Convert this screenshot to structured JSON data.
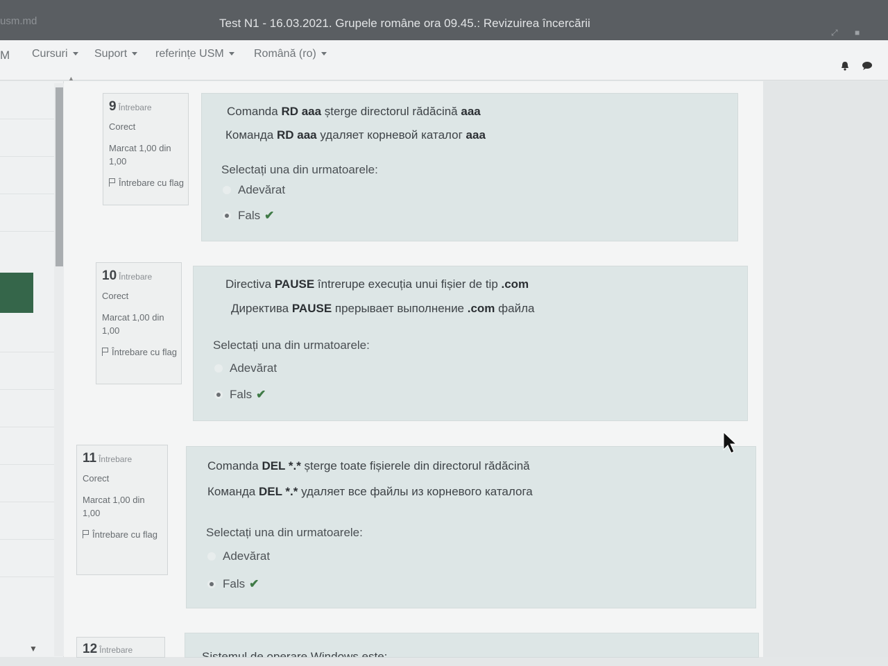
{
  "window": {
    "site": "usm.md",
    "title": "Test N1 - 16.03.2021. Grupele române ora 09.45.: Revizuirea încercării",
    "controls": "⁄\\ ■"
  },
  "navbar": {
    "brand": "M",
    "items": [
      {
        "label": "Cursuri"
      },
      {
        "label": "Suport"
      },
      {
        "label": "referințe USM"
      },
      {
        "label": "Română (ro)"
      }
    ],
    "icons": [
      "bell-icon",
      "chat-icon"
    ]
  },
  "questions": [
    {
      "number": "9",
      "word": "Întrebare",
      "status": "Corect",
      "marked": "Marcat 1,00 din 1,00",
      "flag": "Întrebare cu flag",
      "ro": {
        "p1": "Comanda ",
        "b1": "RD  aaa",
        "p2": " șterge directorul rădăcină ",
        "b2": "aaa"
      },
      "ru": {
        "p1": "Команда ",
        "b1": "RD  aaa",
        "p2": " удаляет корневой каталог  ",
        "b2": "aaa"
      },
      "prompt": "Selectați una din urmatoarele:",
      "options": [
        "Adevărat",
        "Fals"
      ],
      "selected": "Fals"
    },
    {
      "number": "10",
      "word": "Întrebare",
      "status": "Corect",
      "marked": "Marcat 1,00 din 1,00",
      "flag": "Întrebare cu flag",
      "ro": {
        "p1": "Directiva ",
        "b1": "PAUSE",
        "p2": " întrerupe execuția unui fișier de tip ",
        "b2": ".com"
      },
      "ru": {
        "p1": "Директива ",
        "b1": "PAUSE",
        "p2": " прерывает выполнение ",
        "b2": ".com",
        "p3": " файла"
      },
      "prompt": "Selectați una din urmatoarele:",
      "options": [
        "Adevărat",
        "Fals"
      ],
      "selected": "Fals"
    },
    {
      "number": "11",
      "word": "Întrebare",
      "status": "Corect",
      "marked": "Marcat 1,00 din 1,00",
      "flag": "Întrebare cu flag",
      "ro": {
        "p1": "Comanda ",
        "b1": "DEL *.*",
        "p2": "  șterge toate fișierele din directorul rădăcină"
      },
      "ru": {
        "p1": "Команда ",
        "b1": "DEL *.*",
        "p2": " удаляет все файлы из корневого каталога"
      },
      "prompt": "Selectați una din urmatoarele:",
      "options": [
        "Adevărat",
        "Fals"
      ],
      "selected": "Fals"
    },
    {
      "number": "12",
      "word": "Întrebare",
      "partial_text": "Sistemul de operare Windows este:"
    }
  ],
  "colors": {
    "accent": "#35664a",
    "check": "#3f7a46",
    "content_bg": "#dde6e6"
  }
}
